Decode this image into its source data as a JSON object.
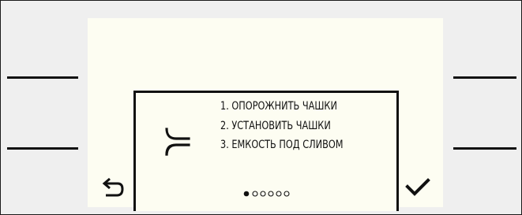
{
  "dialog": {
    "instructions": [
      "1. ОПОРОЖНИТЬ ЧАШКИ",
      "2. УСТАНОВИТЬ ЧАШКИ",
      "3. ЕМКОСТЬ ПОД СЛИВОМ"
    ],
    "icon": "cup-nozzle-icon"
  },
  "pager": {
    "current": 1,
    "total": 6
  },
  "buttons": {
    "back_icon": "back-arrow-icon",
    "confirm_icon": "checkmark-icon"
  },
  "colors": {
    "screen": "#fdfdf2",
    "ink": "#111111",
    "bezel": "#efefef"
  }
}
